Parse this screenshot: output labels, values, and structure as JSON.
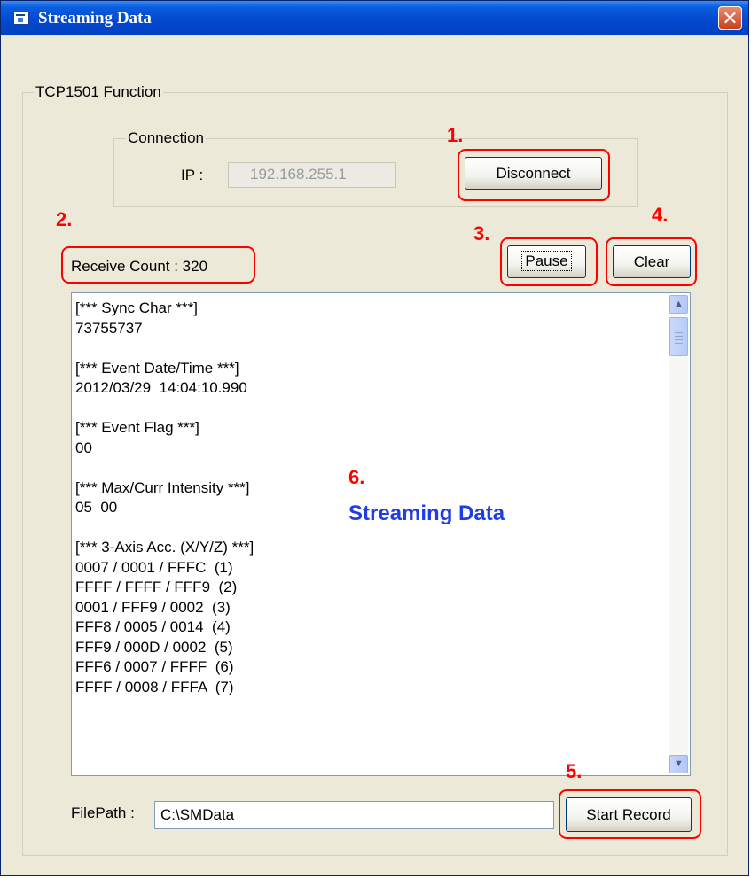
{
  "window": {
    "title": "Streaming Data",
    "close_glyph": "✕"
  },
  "function_group": {
    "label": "TCP1501 Function"
  },
  "connection": {
    "label": "Connection",
    "ip_label": "IP :",
    "ip_value": "192.168.255.1",
    "disconnect_label": "Disconnect"
  },
  "status": {
    "receive_count_label": "Receive Count : 320"
  },
  "controls": {
    "pause_label": "Pause",
    "clear_label": "Clear"
  },
  "stream_lines": [
    "[*** Sync Char ***]",
    "73755737",
    "",
    "[*** Event Date/Time ***]",
    "2012/03/29  14:04:10.990",
    "",
    "[*** Event Flag ***]",
    "00",
    "",
    "[*** Max/Curr Intensity ***]",
    "05  00",
    "",
    "[*** 3-Axis Acc. (X/Y/Z) ***]",
    "0007 / 0001 / FFFC  (1)",
    "FFFF / FFFF / FFF9  (2)",
    "0001 / FFF9 / 0002  (3)",
    "FFF8 / 0005 / 0014  (4)",
    "FFF9 / 000D / 0002  (5)",
    "FFF6 / 0007 / FFFF  (6)",
    "FFFF / 0008 / FFFA  (7)"
  ],
  "record": {
    "filepath_label": "FilePath :",
    "filepath_value": "C:\\SMData",
    "start_record_label": "Start Record"
  },
  "annotations": {
    "n1": "1.",
    "n2": "2.",
    "n3": "3.",
    "n4": "4.",
    "n5": "5.",
    "n6": "6.",
    "streaming_label": "Streaming Data"
  },
  "icons": {
    "window": "window-icon",
    "close": "close-icon",
    "scroll_up": "scroll-up-arrow-icon",
    "scroll_down": "scroll-down-arrow-icon"
  },
  "colors": {
    "titlebar": "#0449D1",
    "window_bg": "#ECE9D8",
    "annotation": "#FF0000",
    "stream_label": "#1E3CE8"
  }
}
